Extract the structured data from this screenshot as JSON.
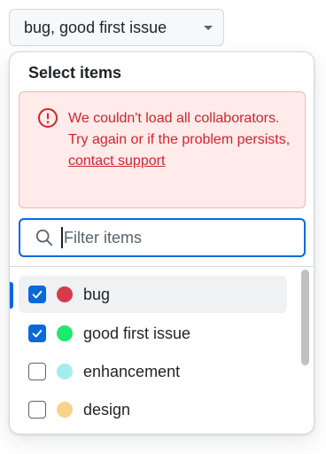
{
  "trigger": {
    "label": "bug, good first issue",
    "caret_icon": "triangle-down-icon"
  },
  "panel": {
    "title": "Select items",
    "error": {
      "icon": "alert-circle-icon",
      "message": "We couldn't load all collaborators. Try again or if the problem persists,",
      "link_text": "contact support",
      "color": "#d1242f",
      "background": "#ffebe9"
    },
    "filter": {
      "icon": "search-icon",
      "placeholder": "Filter items",
      "value": ""
    },
    "items": [
      {
        "label": "bug",
        "checked": true,
        "color": "#d73a4a",
        "hovered": true
      },
      {
        "label": "good first issue",
        "checked": true,
        "color": "#1ee86d",
        "hovered": false
      },
      {
        "label": "enhancement",
        "checked": false,
        "color": "#a2eeef",
        "hovered": false
      },
      {
        "label": "design",
        "checked": false,
        "color": "#f9d38a",
        "hovered": false
      }
    ]
  },
  "colors": {
    "accent": "#0969da",
    "error": "#d1242f"
  }
}
